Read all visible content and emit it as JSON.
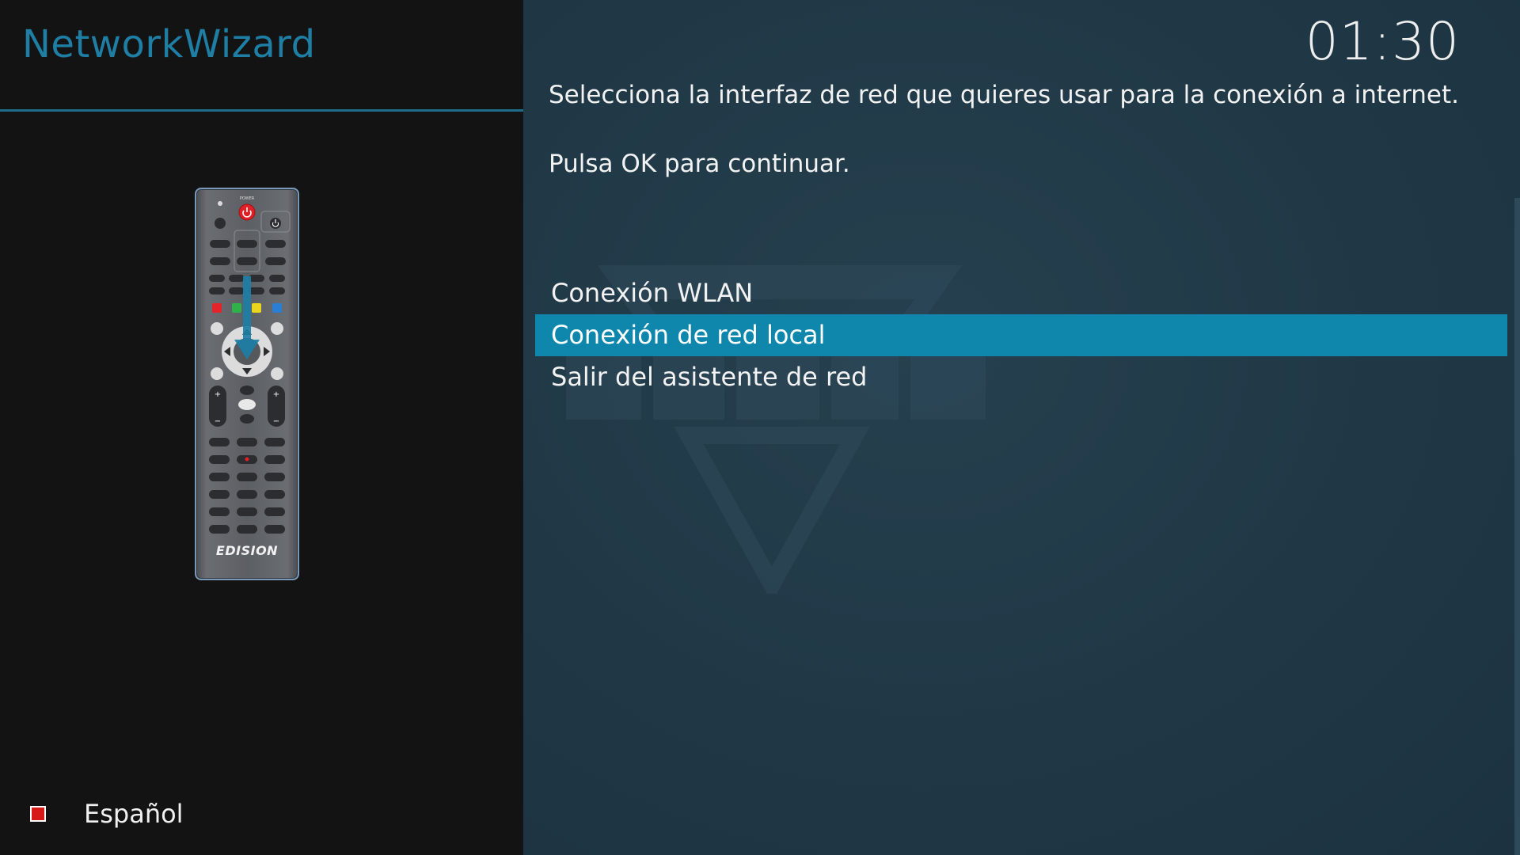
{
  "header": {
    "title": "NetworkWizard",
    "clock": "01:30"
  },
  "remote": {
    "brand": "EDISION",
    "power_label": "POWER"
  },
  "main": {
    "instruction_line_1": "Selecciona la interfaz de red que quieres usar para la conexión a internet.",
    "instruction_line_2": "Pulsa OK para continuar."
  },
  "menu": {
    "items": [
      {
        "label": "Conexión WLAN",
        "selected": false
      },
      {
        "label": "Conexión de red local",
        "selected": true
      },
      {
        "label": "Salir del asistente de red",
        "selected": false
      }
    ]
  },
  "footer": {
    "language_label": "Español",
    "language_flag_color": "#d81919"
  },
  "colors": {
    "accent": "#1e7ea4",
    "selection": "#0f86ac",
    "panel_background": "#203846",
    "sidebar_background": "#131313"
  }
}
